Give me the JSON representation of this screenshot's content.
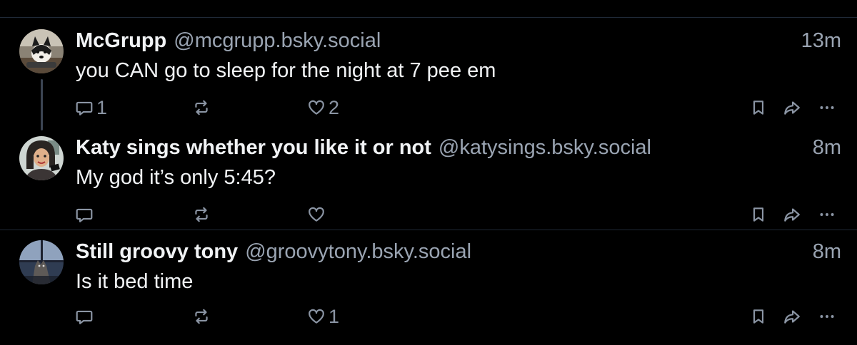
{
  "posts": [
    {
      "display_name": "McGrupp",
      "handle": "@mcgrupp.bsky.social",
      "time": "13m",
      "text": "you CAN go to sleep for the night at 7 pee em",
      "reply_count": "1",
      "repost_count": "",
      "like_count": "2",
      "avatar_icon": "dog-avatar"
    },
    {
      "display_name": "Katy sings whether you like it or not",
      "handle": "@katysings.bsky.social",
      "time": "8m",
      "text": "My god it’s only 5:45?",
      "reply_count": "",
      "repost_count": "",
      "like_count": "",
      "avatar_icon": "cartoon-woman-avatar"
    },
    {
      "display_name": "Still groovy tony",
      "handle": "@groovytony.bsky.social",
      "time": "8m",
      "text": "Is it bed time",
      "reply_count": "",
      "repost_count": "",
      "like_count": "1",
      "avatar_icon": "cat-window-avatar"
    }
  ],
  "colors": {
    "background": "#000000",
    "text": "#f1f3f5",
    "muted": "#9aa4b2",
    "icon": "#8b95a4",
    "divider": "#1f2937",
    "thread_line": "#3b4452"
  }
}
